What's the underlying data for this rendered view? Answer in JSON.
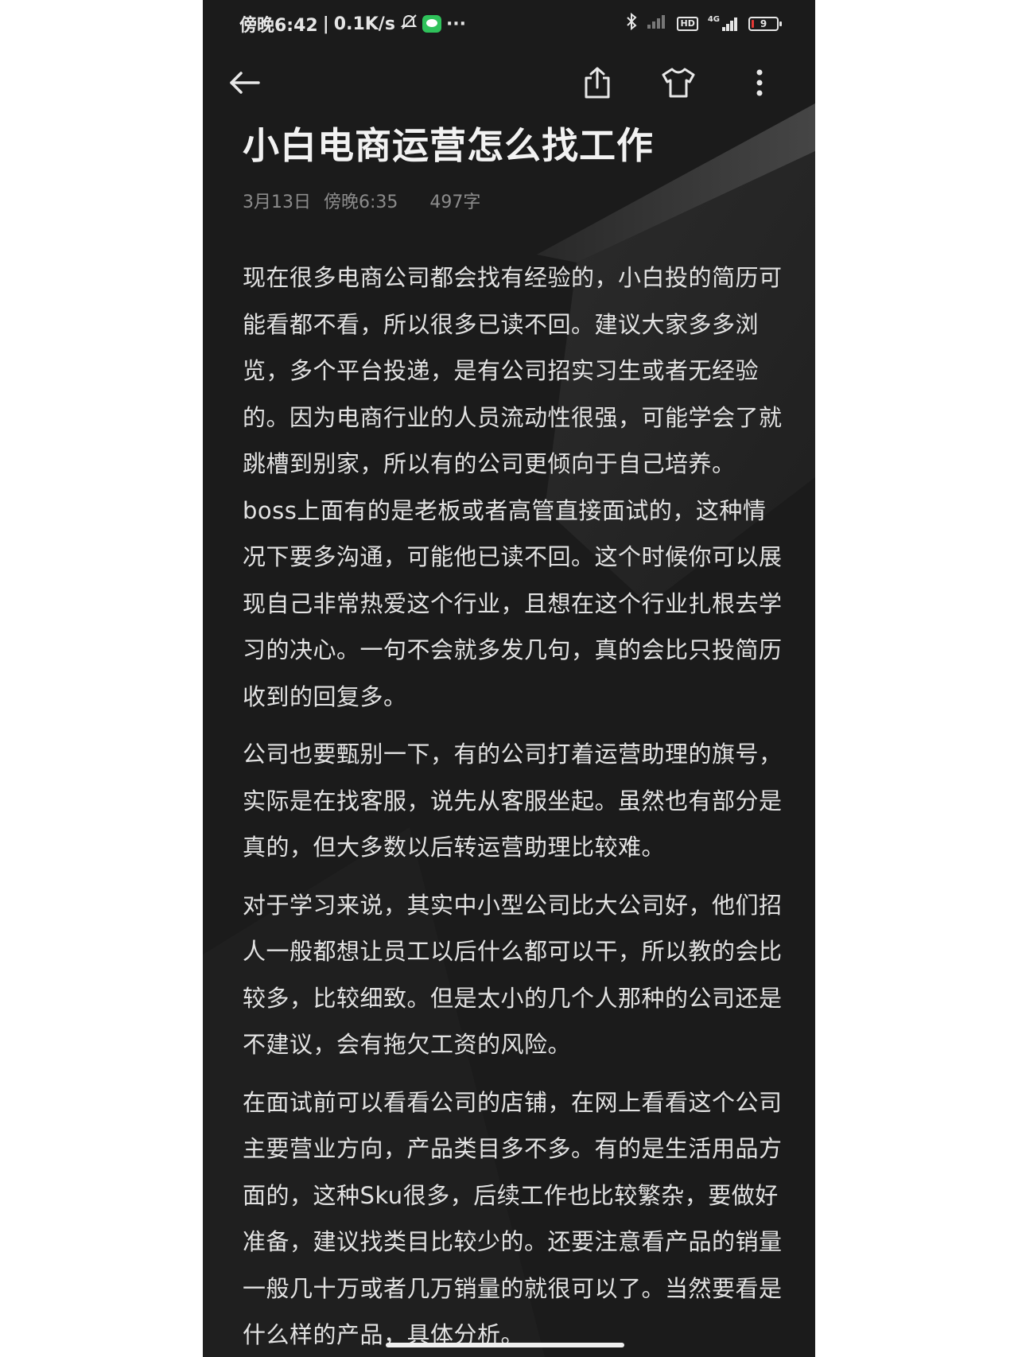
{
  "status_bar": {
    "time": "傍晚6:42",
    "separator": "|",
    "net_speed": "0.1K/s",
    "more_dots": "···",
    "hd_label": "HD",
    "network_label": "4G",
    "battery_level": "9"
  },
  "note": {
    "title": "小白电商运营怎么找工作",
    "date": "3月13日",
    "time": "傍晚6:35",
    "word_count": "497字",
    "paragraphs": [
      "现在很多电商公司都会找有经验的，小白投的简历可能看都不看，所以很多已读不回。建议大家多多浏览，多个平台投递，是有公司招实习生或者无经验的。因为电商行业的人员流动性很强，可能学会了就跳槽到别家，所以有的公司更倾向于自己培养。boss上面有的是老板或者高管直接面试的，这种情况下要多沟通，可能他已读不回。这个时候你可以展现自己非常热爱这个行业，且想在这个行业扎根去学习的决心。一句不会就多发几句，真的会比只投简历收到的回复多。",
      "公司也要甄别一下，有的公司打着运营助理的旗号，实际是在找客服，说先从客服坐起。虽然也有部分是真的，但大多数以后转运营助理比较难。",
      "对于学习来说，其实中小型公司比大公司好，他们招人一般都想让员工以后什么都可以干，所以教的会比较多，比较细致。但是太小的几个人那种的公司还是不建议，会有拖欠工资的风险。",
      "在面试前可以看看公司的店铺，在网上看看这个公司主要营业方向，产品类目多不多。有的是生活用品方面的，这种Sku很多，后续工作也比较繁杂，要做好准备，建议找类目比较少的。还要注意看产品的销量一般几十万或者几万销量的就很可以了。当然要看是什么样的产品，具体分析。"
    ]
  },
  "icons": {
    "back": "arrow-left-icon",
    "share": "share-icon",
    "theme": "tshirt-icon",
    "more": "more-vertical-icon"
  }
}
